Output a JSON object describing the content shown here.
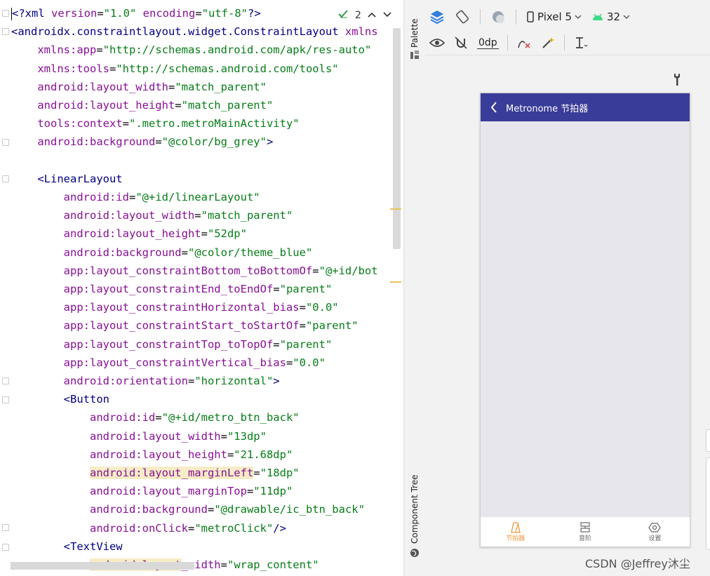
{
  "editor": {
    "lines": [
      {
        "segments": [
          [
            "kw",
            "<?"
          ],
          [
            "tag",
            "xml "
          ],
          [
            "attr",
            "version"
          ],
          [
            "plain",
            "="
          ],
          [
            "str",
            "\"1.0\" "
          ],
          [
            "attr",
            "encoding"
          ],
          [
            "plain",
            "="
          ],
          [
            "str",
            "\"utf-8\""
          ],
          [
            "kw",
            "?>"
          ]
        ]
      },
      {
        "segments": [
          [
            "tag",
            "<androidx.constraintlayout.widget.ConstraintLayout "
          ],
          [
            "attr",
            "xmlns"
          ]
        ]
      },
      {
        "segments": [
          [
            "plain",
            "    "
          ],
          [
            "ns",
            "xmlns:app"
          ],
          [
            "plain",
            "="
          ],
          [
            "str",
            "\"http://schemas.android.com/apk/res-auto\""
          ]
        ]
      },
      {
        "segments": [
          [
            "plain",
            "    "
          ],
          [
            "ns",
            "xmlns:tools"
          ],
          [
            "plain",
            "="
          ],
          [
            "str",
            "\"http://schemas.android.com/tools\""
          ]
        ]
      },
      {
        "segments": [
          [
            "plain",
            "    "
          ],
          [
            "attr",
            "android:layout_width"
          ],
          [
            "plain",
            "="
          ],
          [
            "str",
            "\"match_parent\""
          ]
        ]
      },
      {
        "segments": [
          [
            "plain",
            "    "
          ],
          [
            "attr",
            "android:layout_height"
          ],
          [
            "plain",
            "="
          ],
          [
            "str",
            "\"match_parent\""
          ]
        ]
      },
      {
        "segments": [
          [
            "plain",
            "    "
          ],
          [
            "attr",
            "tools:context"
          ],
          [
            "plain",
            "="
          ],
          [
            "str",
            "\".metro.metroMainActivity\""
          ]
        ]
      },
      {
        "segments": [
          [
            "plain",
            "    "
          ],
          [
            "attr",
            "android:background"
          ],
          [
            "plain",
            "="
          ],
          [
            "str",
            "\"@color/bg_grey\""
          ],
          [
            "tag",
            ">"
          ]
        ]
      },
      {
        "segments": []
      },
      {
        "segments": [
          [
            "plain",
            "    "
          ],
          [
            "tag",
            "<LinearLayout"
          ]
        ]
      },
      {
        "segments": [
          [
            "plain",
            "        "
          ],
          [
            "attr",
            "android:id"
          ],
          [
            "plain",
            "="
          ],
          [
            "str",
            "\"@+id/linearLayout\""
          ]
        ]
      },
      {
        "segments": [
          [
            "plain",
            "        "
          ],
          [
            "attr",
            "android:layout_width"
          ],
          [
            "plain",
            "="
          ],
          [
            "str",
            "\"match_parent\""
          ]
        ]
      },
      {
        "segments": [
          [
            "plain",
            "        "
          ],
          [
            "attr",
            "android:layout_height"
          ],
          [
            "plain",
            "="
          ],
          [
            "str",
            "\"52dp\""
          ]
        ]
      },
      {
        "segments": [
          [
            "plain",
            "        "
          ],
          [
            "attr",
            "android:background"
          ],
          [
            "plain",
            "="
          ],
          [
            "str",
            "\"@color/theme_blue\""
          ]
        ]
      },
      {
        "segments": [
          [
            "plain",
            "        "
          ],
          [
            "attr",
            "app:layout_constraintBottom_toBottomOf"
          ],
          [
            "plain",
            "="
          ],
          [
            "str",
            "\"@+id/bot"
          ]
        ]
      },
      {
        "segments": [
          [
            "plain",
            "        "
          ],
          [
            "attr",
            "app:layout_constraintEnd_toEndOf"
          ],
          [
            "plain",
            "="
          ],
          [
            "str",
            "\"parent\""
          ]
        ]
      },
      {
        "segments": [
          [
            "plain",
            "        "
          ],
          [
            "attr",
            "app:layout_constraintHorizontal_bias"
          ],
          [
            "plain",
            "="
          ],
          [
            "str",
            "\"0.0\""
          ]
        ]
      },
      {
        "segments": [
          [
            "plain",
            "        "
          ],
          [
            "attr",
            "app:layout_constraintStart_toStartOf"
          ],
          [
            "plain",
            "="
          ],
          [
            "str",
            "\"parent\""
          ]
        ]
      },
      {
        "segments": [
          [
            "plain",
            "        "
          ],
          [
            "attr",
            "app:layout_constraintTop_toTopOf"
          ],
          [
            "plain",
            "="
          ],
          [
            "str",
            "\"parent\""
          ]
        ]
      },
      {
        "segments": [
          [
            "plain",
            "        "
          ],
          [
            "attr",
            "app:layout_constraintVertical_bias"
          ],
          [
            "plain",
            "="
          ],
          [
            "str",
            "\"0.0\""
          ]
        ]
      },
      {
        "segments": [
          [
            "plain",
            "        "
          ],
          [
            "attr",
            "android:orientation"
          ],
          [
            "plain",
            "="
          ],
          [
            "str",
            "\"horizontal\""
          ],
          [
            "tag",
            ">"
          ]
        ]
      },
      {
        "segments": [
          [
            "plain",
            "        "
          ],
          [
            "tag",
            "<Button"
          ]
        ]
      },
      {
        "segments": [
          [
            "plain",
            "            "
          ],
          [
            "attr",
            "android:id"
          ],
          [
            "plain",
            "="
          ],
          [
            "str",
            "\"@+id/metro_btn_back\""
          ]
        ]
      },
      {
        "segments": [
          [
            "plain",
            "            "
          ],
          [
            "attr",
            "android:layout_width"
          ],
          [
            "plain",
            "="
          ],
          [
            "str",
            "\"13dp\""
          ]
        ]
      },
      {
        "segments": [
          [
            "plain",
            "            "
          ],
          [
            "attr",
            "android:layout_height"
          ],
          [
            "plain",
            "="
          ],
          [
            "str",
            "\"21.68dp\""
          ]
        ]
      },
      {
        "segments": [
          [
            "plain",
            "            "
          ],
          [
            "hl",
            "android:layout_marginLeft"
          ],
          [
            "plain",
            "="
          ],
          [
            "str",
            "\"18dp\""
          ]
        ]
      },
      {
        "segments": [
          [
            "plain",
            "            "
          ],
          [
            "attr",
            "android:layout_marginTop"
          ],
          [
            "plain",
            "="
          ],
          [
            "str",
            "\"11dp\""
          ]
        ]
      },
      {
        "segments": [
          [
            "plain",
            "            "
          ],
          [
            "attr",
            "android:background"
          ],
          [
            "plain",
            "="
          ],
          [
            "str",
            "\"@drawable/ic_btn_back\""
          ]
        ]
      },
      {
        "segments": [
          [
            "plain",
            "            "
          ],
          [
            "attr",
            "android:onClick"
          ],
          [
            "plain",
            "="
          ],
          [
            "str",
            "\"metroClick\""
          ],
          [
            "tag",
            "/>"
          ]
        ]
      },
      {
        "segments": [
          [
            "plain",
            "        "
          ],
          [
            "tag",
            "<TextView"
          ]
        ]
      },
      {
        "segments": [
          [
            "plain",
            "            "
          ],
          [
            "hl",
            "android:layout"
          ],
          [
            "attr",
            "_width"
          ],
          [
            "plain",
            "="
          ],
          [
            "str",
            "\"wrap_content\""
          ]
        ]
      }
    ],
    "hint_count": "2"
  },
  "side_strip": {
    "palette_label": "Palette",
    "component_tree_label": "Component Tree"
  },
  "design": {
    "device": "Pixel 5",
    "api_level": "32",
    "margin_value": "0dp",
    "app_title": "Metronome 节拍器",
    "nav": [
      {
        "label": "节拍器",
        "active": true
      },
      {
        "label": "音阶",
        "active": false
      },
      {
        "label": "设置",
        "active": false
      }
    ]
  },
  "watermark": "CSDN @Jeffrey沐尘",
  "colors": {
    "theme_blue": "#3a3c99",
    "bg_grey": "#e7e6ed",
    "accent_orange": "#f0963c"
  }
}
